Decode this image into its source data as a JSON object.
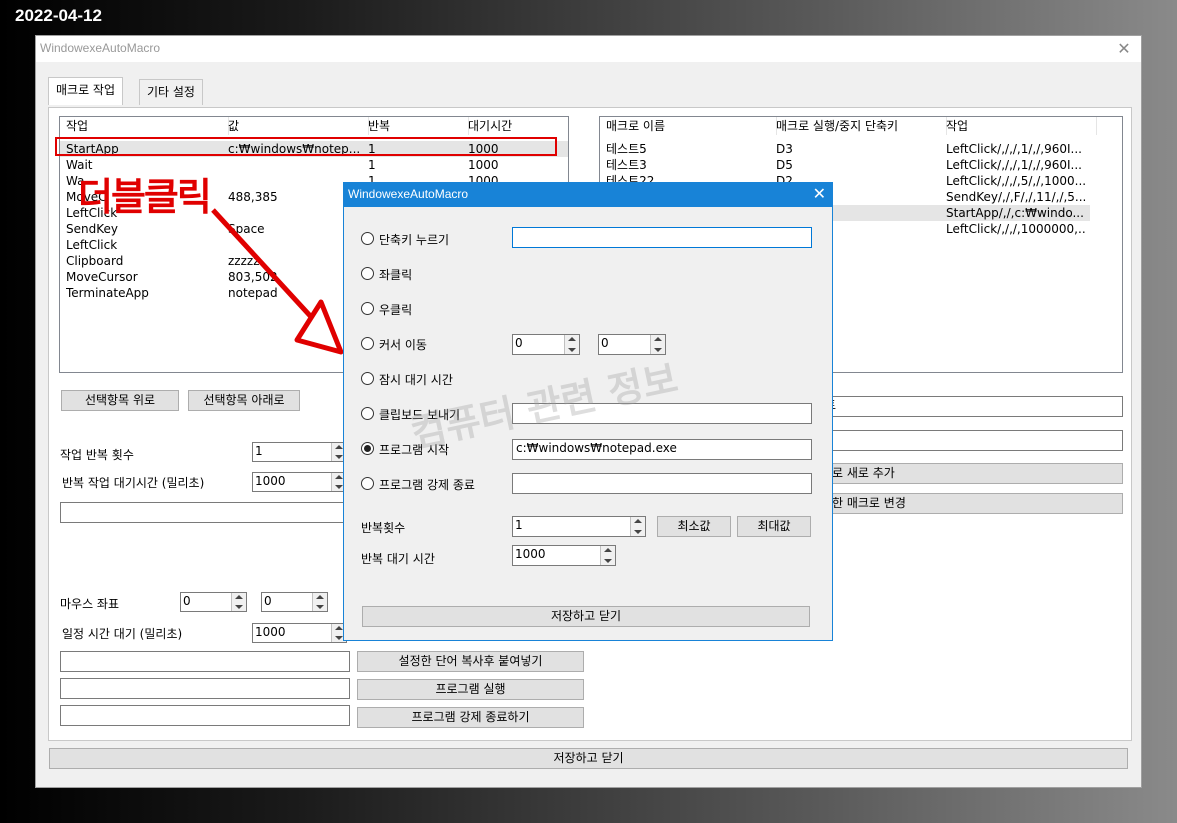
{
  "date_label": "2022-04-12",
  "window": {
    "title": "WindowexeAutoMacro",
    "tabs": [
      {
        "label": "매크로 작업"
      },
      {
        "label": "기타 설정"
      }
    ]
  },
  "left_list": {
    "headers": [
      "작업",
      "값",
      "반복",
      "대기시간"
    ],
    "rows": [
      [
        "StartApp",
        "c:₩windows₩notep...",
        "1",
        "1000"
      ],
      [
        "Wait",
        "",
        "1",
        "1000"
      ],
      [
        "Wa",
        "",
        "1",
        "1000"
      ],
      [
        "MoveC",
        "488,385",
        "",
        ""
      ],
      [
        "LeftClick",
        "",
        "",
        ""
      ],
      [
        "SendKey",
        "Space",
        "",
        ""
      ],
      [
        "LeftClick",
        "",
        "",
        ""
      ],
      [
        "Clipboard",
        "zzzzz",
        "",
        ""
      ],
      [
        "MoveCursor",
        "803,502",
        "",
        ""
      ],
      [
        "TerminateApp",
        "notepad",
        "",
        ""
      ]
    ]
  },
  "right_list": {
    "headers": [
      "매크로 이름",
      "매크로 실행/중지 단축키",
      "작업"
    ],
    "rows": [
      [
        "테스트5",
        "D3",
        "LeftClick/,/,/,1/,/,960I..."
      ],
      [
        "테스트3",
        "D5",
        "LeftClick/,/,/,1/,/,960I..."
      ],
      [
        "테스트22",
        "D2",
        "LeftClick/,/,/,5/,/,1000..."
      ],
      [
        "",
        "",
        "SendKey/,/,F/,/,11/,/,5..."
      ],
      [
        "",
        "",
        "StartApp/,/,c:₩windo..."
      ],
      [
        "",
        "",
        "LeftClick/,/,/,1000000,..."
      ]
    ]
  },
  "main": {
    "btn_up": "선택항목 위로",
    "btn_down": "선택항목 아래로",
    "repeat_count_label": "작업 반복 횟수",
    "repeat_count": "1",
    "repeat_wait_label": "반복 작업 대기시간 (밀리초)",
    "repeat_wait": "1000",
    "mouse_coord_label": "마우스 좌표",
    "mouse_x": "0",
    "mouse_y": "0",
    "wait_label": "일정 시간 대기 (밀리초)",
    "wait_value": "1000",
    "btn_paste": "설정한 단어 복사후 붙여넣기",
    "btn_run": "프로그램 실행",
    "btn_kill": "프로그램 강제 종료하기",
    "right_input_1_tail": "트",
    "btn_add_macro": "로 새로 추가",
    "btn_change_macro": "한 매크로 변경",
    "save_close": "저장하고 닫기"
  },
  "dialog": {
    "title": "WindowexeAutoMacro",
    "options": [
      {
        "label": "단축키 누르기",
        "selected": false
      },
      {
        "label": "좌클릭",
        "selected": false
      },
      {
        "label": "우클릭",
        "selected": false
      },
      {
        "label": "커서 이동",
        "selected": false
      },
      {
        "label": "잠시 대기 시간",
        "selected": false
      },
      {
        "label": "클립보드 보내기",
        "selected": false
      },
      {
        "label": "프로그램 시작",
        "selected": true
      },
      {
        "label": "프로그램 강제 종료",
        "selected": false
      }
    ],
    "cursor_x": "0",
    "cursor_y": "0",
    "program_path": "c:₩windows₩notepad.exe",
    "repeat_label": "반복횟수",
    "repeat_value": "1",
    "min_button": "최소값",
    "max_button": "최대값",
    "repeat_wait_label": "반복 대기 시간",
    "repeat_wait_value": "1000",
    "save_close": "저장하고 닫기"
  },
  "annotation": {
    "text": "더블클릭",
    "color": "#e00000"
  },
  "watermark": "컴퓨터 관련 정보"
}
